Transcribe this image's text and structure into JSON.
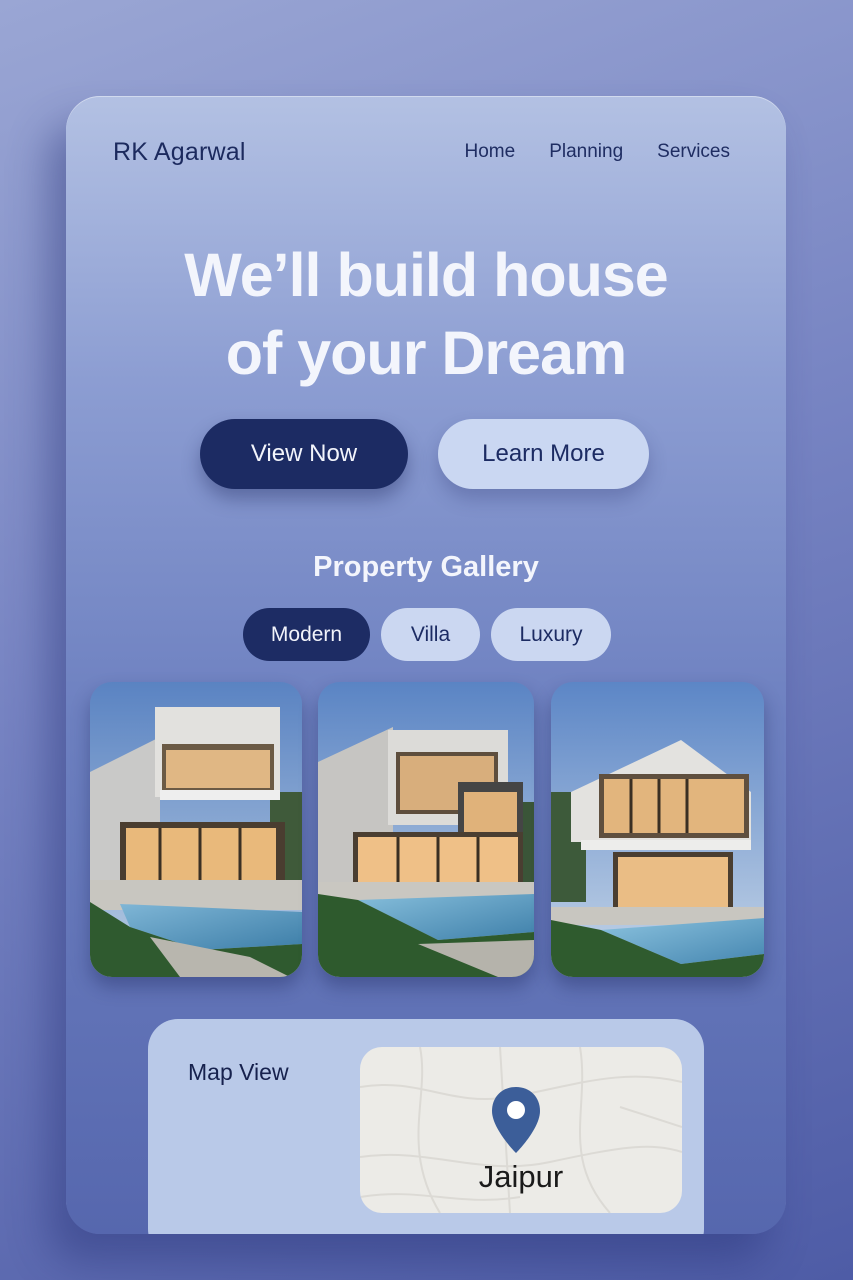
{
  "header": {
    "brand": "RK Agarwal",
    "nav": [
      "Home",
      "Planning",
      "Services"
    ]
  },
  "hero": {
    "line1": "We’ll build house",
    "line2": "of your Dream"
  },
  "cta": {
    "primary_label": "View Now",
    "secondary_label": "Learn More"
  },
  "gallery": {
    "title": "Property Gallery",
    "filters": [
      "Modern",
      "Villa",
      "Luxury"
    ],
    "active_filter": "Modern",
    "photos": [
      "house-photo",
      "house-photo",
      "house-photo"
    ]
  },
  "map": {
    "label": "Map View",
    "city": "Jaipur",
    "pin_icon": "location-pin-icon"
  },
  "colors": {
    "accent_dark": "#1c2b63",
    "accent_light": "#cad7f2",
    "card_top": "#b3c1e3",
    "card_bottom": "#5667ae",
    "map_pin": "#3c5e99"
  }
}
